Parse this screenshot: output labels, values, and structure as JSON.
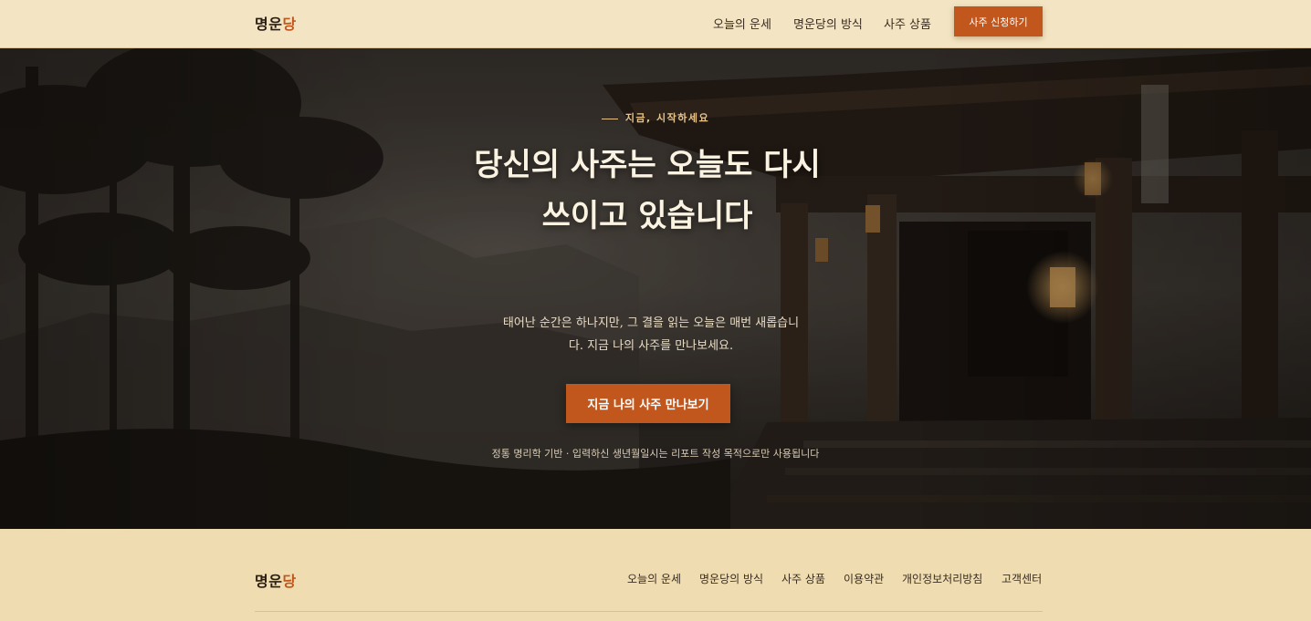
{
  "brand": {
    "name_main": "명운",
    "name_accent": "당"
  },
  "header": {
    "nav": [
      "오늘의 운세",
      "명운당의 방식",
      "사주 상품"
    ],
    "cta_label": "사주 신청하기"
  },
  "hero": {
    "eyebrow": "지금, 시작하세요",
    "title": "당신의 사주는 오늘도 다시 쓰이고 있습니다",
    "description": "태어난 순간은 하나지만, 그 결을 읽는 오늘은 매번 새롭습니다. 지금 나의 사주를 만나보세요.",
    "cta_label": "지금 나의 사주 만나보기",
    "note": "정통 명리학 기반 · 입력하신 생년월일시는 리포트 작성 목적으로만 사용됩니다"
  },
  "footer": {
    "nav": [
      "오늘의 운세",
      "명운당의 방식",
      "사주 상품",
      "이용약관",
      "개인정보처리방침",
      "고객센터"
    ]
  },
  "colors": {
    "accent": "#c2571d",
    "header_bg": "#f3e5c3",
    "footer_bg": "#efdcb0",
    "eyebrow": "#e9c48a"
  }
}
